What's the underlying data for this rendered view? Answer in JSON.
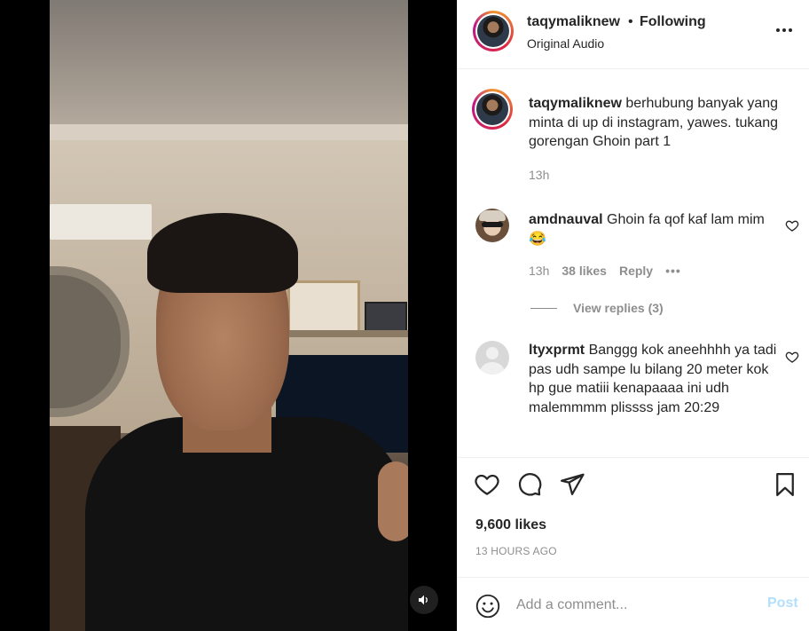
{
  "header": {
    "username": "taqymaliknew",
    "separator": "•",
    "follow_status": "Following",
    "subtitle": "Original Audio"
  },
  "caption": {
    "username": "taqymaliknew",
    "text": " berhubung banyak yang minta di up di instagram, yawes. tukang gorengan Ghoin part 1",
    "time": "13h"
  },
  "comments": [
    {
      "username": "amdnauval",
      "text": " Ghoin fa qof kaf lam mim 😂",
      "time": "13h",
      "likes": "38 likes",
      "reply": "Reply",
      "more": "•••",
      "view_replies": "View replies (3)"
    },
    {
      "username": "ltyxprmt",
      "text": " Banggg kok aneehhhh ya tadi pas udh sampe lu bilang 20 meter kok hp gue matiii kenapaaaa ini udh malemmmm plissss jam 20:29"
    }
  ],
  "post_meta": {
    "likes": "9,600 likes",
    "timestamp": "13 HOURS AGO"
  },
  "add_comment": {
    "placeholder": "Add a comment...",
    "post_label": "Post",
    "post_color": "#b2dffc"
  },
  "icons": {
    "more": "more-options-icon",
    "like": "heart-icon",
    "comment": "comment-bubble-icon",
    "share": "paper-plane-icon",
    "save": "bookmark-icon",
    "emoji": "smiley-icon",
    "audio": "speaker-icon"
  }
}
